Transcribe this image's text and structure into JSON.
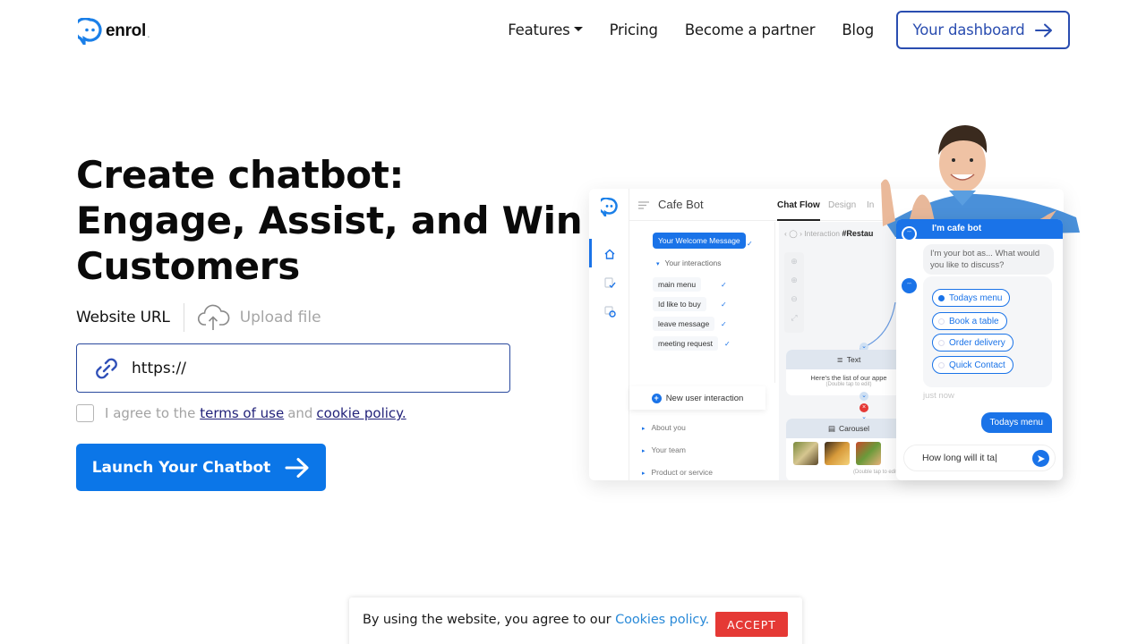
{
  "brand": {
    "name": "enrol",
    "accent": "#0b76e8",
    "dark_accent": "#2a4db0"
  },
  "nav": {
    "items": [
      {
        "label": "Features",
        "has_dropdown": true
      },
      {
        "label": "Pricing"
      },
      {
        "label": "Become a partner"
      },
      {
        "label": "Blog"
      }
    ],
    "dashboard_button": "Your dashboard"
  },
  "hero": {
    "title_lines": [
      "Create chatbot:",
      "Engage, Assist, and Win",
      "Customers"
    ],
    "source_modes": {
      "url": "Website URL",
      "upload": "Upload file"
    },
    "url_input": {
      "value": "https://",
      "placeholder": "https://"
    },
    "agree": {
      "prefix": "I agree to the",
      "terms_link": "terms of use",
      "and": "and",
      "cookie_link": "cookie policy."
    },
    "launch_button": "Launch Your Chatbot"
  },
  "mockup": {
    "bot_name": "Cafe Bot",
    "tabs": [
      "Chat Flow",
      "Design",
      "In"
    ],
    "welcome_message": "Your Welcome Message",
    "interactions_header": "Your interactions",
    "interactions": [
      "main menu",
      "Id like to buy",
      "leave message",
      "meeting request"
    ],
    "new_interaction": "New user interaction",
    "sections": [
      "About you",
      "Your team",
      "Product or service"
    ],
    "breadcrumb": {
      "label": "Interaction",
      "value": "#Restau"
    },
    "flow_cards": [
      {
        "type": "Text",
        "body": "Here's the list of our appe",
        "hint": "(Double tap to edit)"
      },
      {
        "type": "Carousel",
        "hint": "(Double tap to edit)"
      }
    ]
  },
  "chat_widget": {
    "header": "I'm cafe bot",
    "greeting": "I'm your bot as... What would you like to discuss?",
    "options": [
      {
        "label": "Todays menu",
        "selected": true
      },
      {
        "label": "Book a table",
        "selected": false
      },
      {
        "label": "Order delivery",
        "selected": false
      },
      {
        "label": "Quick Contact",
        "selected": false
      }
    ],
    "timestamp": "just now",
    "user_message": "Todays menu",
    "input_value": "How long will it ta"
  },
  "cookie_bar": {
    "text": "By using the website, you agree to our",
    "link": "Cookies policy.",
    "accept": "ACCEPT"
  }
}
